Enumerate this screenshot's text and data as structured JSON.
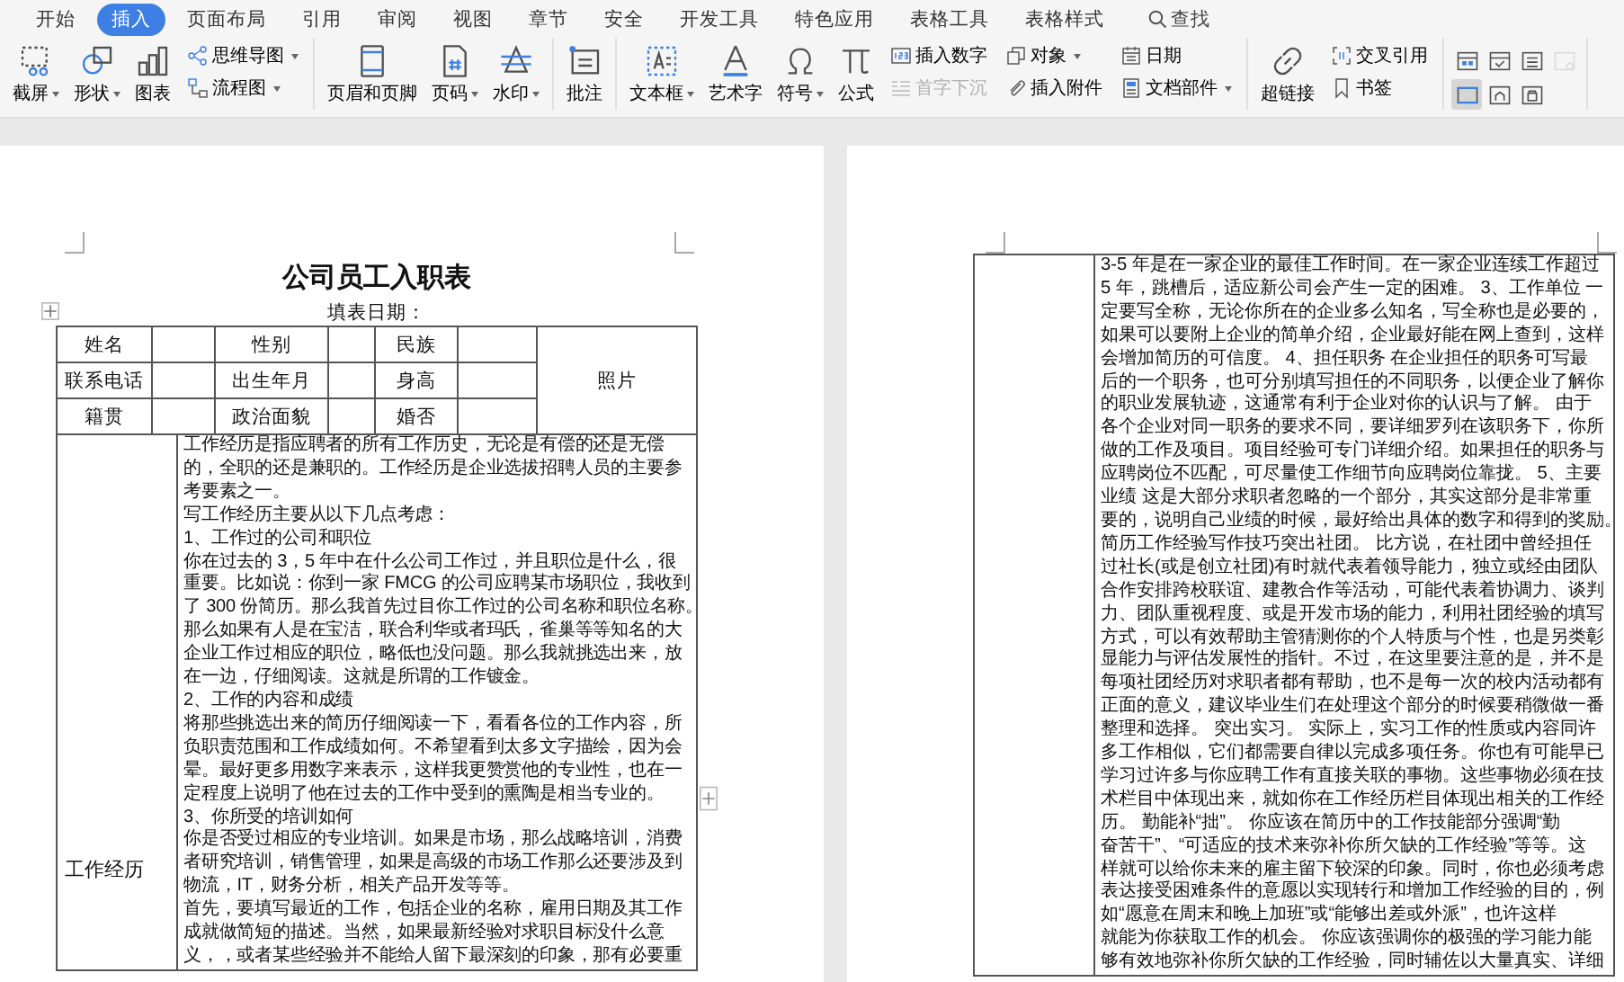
{
  "tabs": [
    {
      "label": "开始",
      "selected": false
    },
    {
      "label": "插入",
      "selected": true
    },
    {
      "label": "页面布局",
      "selected": false
    },
    {
      "label": "引用",
      "selected": false
    },
    {
      "label": "审阅",
      "selected": false
    },
    {
      "label": "视图",
      "selected": false
    },
    {
      "label": "章节",
      "selected": false
    },
    {
      "label": "安全",
      "selected": false
    },
    {
      "label": "开发工具",
      "selected": false
    },
    {
      "label": "特色应用",
      "selected": false
    },
    {
      "label": "表格工具",
      "selected": false
    },
    {
      "label": "表格样式",
      "selected": false
    }
  ],
  "search": {
    "label": "查找"
  },
  "ribbon": [
    {
      "columns": [
        {
          "kind": "large",
          "buttons": [
            {
              "label": "截屏",
              "dropdown": true,
              "disabled": false
            }
          ]
        },
        {
          "kind": "large",
          "buttons": [
            {
              "label": "形状",
              "dropdown": true,
              "disabled": false
            }
          ]
        },
        {
          "kind": "large",
          "buttons": [
            {
              "label": "图表",
              "dropdown": false,
              "disabled": false
            }
          ]
        },
        {
          "kind": "small",
          "buttons": [
            {
              "label": "思维导图",
              "dropdown": true,
              "disabled": false
            },
            {
              "label": "流程图",
              "dropdown": true,
              "disabled": false
            }
          ]
        }
      ]
    },
    {
      "columns": [
        {
          "kind": "large",
          "buttons": [
            {
              "label": "页眉和页脚",
              "dropdown": false,
              "disabled": false
            }
          ]
        },
        {
          "kind": "large",
          "buttons": [
            {
              "label": "页码",
              "dropdown": true,
              "disabled": false
            }
          ]
        },
        {
          "kind": "large",
          "buttons": [
            {
              "label": "水印",
              "dropdown": true,
              "disabled": false
            }
          ]
        }
      ]
    },
    {
      "columns": [
        {
          "kind": "large",
          "buttons": [
            {
              "label": "批注",
              "dropdown": false,
              "disabled": false
            }
          ]
        }
      ]
    },
    {
      "columns": [
        {
          "kind": "large",
          "buttons": [
            {
              "label": "文本框",
              "dropdown": true,
              "disabled": false
            }
          ]
        },
        {
          "kind": "large",
          "buttons": [
            {
              "label": "艺术字",
              "dropdown": false,
              "disabled": false
            }
          ]
        },
        {
          "kind": "large",
          "buttons": [
            {
              "label": "符号",
              "dropdown": true,
              "disabled": false
            }
          ]
        },
        {
          "kind": "large",
          "buttons": [
            {
              "label": "公式",
              "dropdown": false,
              "disabled": false
            }
          ]
        },
        {
          "kind": "small",
          "buttons": [
            {
              "label": "插入数字",
              "dropdown": false,
              "disabled": false
            },
            {
              "label": "首字下沉",
              "dropdown": false,
              "disabled": true
            }
          ]
        },
        {
          "kind": "small",
          "buttons": [
            {
              "label": "对象",
              "dropdown": true,
              "disabled": false
            },
            {
              "label": "插入附件",
              "dropdown": false,
              "disabled": false
            }
          ]
        },
        {
          "kind": "small",
          "buttons": [
            {
              "label": "日期",
              "dropdown": false,
              "disabled": false
            },
            {
              "label": "文档部件",
              "dropdown": true,
              "disabled": false
            }
          ]
        }
      ]
    },
    {
      "columns": [
        {
          "kind": "large",
          "buttons": [
            {
              "label": "超链接",
              "dropdown": false,
              "disabled": false
            }
          ]
        },
        {
          "kind": "small",
          "buttons": [
            {
              "label": "交叉引用",
              "dropdown": false,
              "disabled": false
            },
            {
              "label": "书签",
              "dropdown": false,
              "disabled": false
            }
          ]
        }
      ]
    },
    {
      "columns": [
        {
          "kind": "grid",
          "buttons": [
            {
              "selected": false,
              "disabled": false
            },
            {
              "selected": false,
              "disabled": false
            },
            {
              "selected": false,
              "disabled": false
            },
            {
              "selected": false,
              "disabled": true
            },
            {
              "selected": true,
              "disabled": false
            },
            {
              "selected": false,
              "disabled": false
            },
            {
              "selected": false,
              "disabled": false
            }
          ]
        }
      ]
    }
  ],
  "form": {
    "title": "公司员工入职表",
    "date_label": "填表日期：",
    "rows": [
      [
        "姓名",
        "性别",
        "民族"
      ],
      [
        "联系电话",
        "出生年月",
        "身高"
      ],
      [
        "籍贯",
        "政治面貌",
        "婚否"
      ]
    ],
    "photo_label": "照片",
    "experience_label": "工作经历",
    "experience_lines": [
      "工作经历是指应聘者的所有工作历史，无论是有偿的还是无偿",
      "的，全职的还是兼职的。工作经历是企业选拔招聘人员的主要参",
      "考要素之一。",
      "写工作经历主要从以下几点考虑：",
      "1、工作过的公司和职位",
      "你在过去的 3，5 年中在什么公司工作过，并且职位是什么，很",
      "重要。比如说：你到一家 FMCG 的公司应聘某市场职位，我收到",
      "了 300 份简历。那么我首先过目你工作过的公司名称和职位名称。",
      "那么如果有人是在宝洁，联合利华或者玛氏，雀巢等等知名的大",
      "企业工作过相应的职位，略低也没问题。那么我就挑选出来，放",
      "在一边，仔细阅读。这就是所谓的工作镀金。",
      "2、工作的内容和成绩",
      "将那些挑选出来的简历仔细阅读一下，看看各位的工作内容，所",
      "负职责范围和工作成绩如何。不希望看到太多文字描绘，因为会",
      "晕。最好更多用数字来表示，这样我更赞赏他的专业性，也在一",
      "定程度上说明了他在过去的工作中受到的熏陶是相当专业的。",
      "3、你所受的培训如何",
      "你是否受过相应的专业培训。如果是市场，那么战略培训，消费",
      "者研究培训，销售管理，如果是高级的市场工作那么还要涉及到",
      "物流，IT，财务分析，相关产品开发等等。",
      "首先，要填写最近的工作，包括企业的名称，雇用日期及其工作",
      "成就做简短的描述。当然，如果最新经验对求职目标没什么意",
      "义，，或者某些经验并不能给人留下最深刻的印象，那有必要重"
    ]
  },
  "continued_lines": [
    "3-5 年是在一家企业的最佳工作时间。在一家企业连续工作超过",
    "5 年，跳槽后，适应新公司会产生一定的困难。 3、工作单位 一",
    "定要写全称，无论你所在的企业多么知名，写全称也是必要的，",
    "如果可以要附上企业的简单介绍，企业最好能在网上查到，这样",
    "会增加简历的可信度。 4、担任职务 在企业担任的职务可写最",
    "后的一个职务，也可分别填写担任的不同职务，以便企业了解你",
    "的职业发展轨迹，这通常有利于企业对你的认识与了解。 由于",
    "各个企业对同一职务的要求不同，要详细罗列在该职务下，你所",
    "做的工作及项目。项目经验可专门详细介绍。如果担任的职务与",
    "应聘岗位不匹配，可尽量使工作细节向应聘岗位靠拢。 5、主要",
    "业绩 这是大部分求职者忽略的一个部分，其实这部分是非常重",
    "要的，说明自己业绩的时候，最好给出具体的数字和得到的奖励。",
    "简历工作经验写作技巧突出社团。 比方说，在社团中曾经担任",
    "过社长(或是创立社团)有时就代表着领导能力，独立或经由团队",
    "合作安排跨校联谊、建教合作等活动，可能代表着协调力、谈判",
    "力、团队重视程度、或是开发市场的能力，利用社团经验的填写",
    "方式，可以有效帮助主管猜测你的个人特质与个性，也是另类彰",
    "显能力与评估发展性的指针。不过，在这里要注意的是，并不是",
    "每项社团经历对求职者都有帮助，也不是每一次的校内活动都有",
    "正面的意义，建议毕业生们在处理这个部分的时候要稍微做一番",
    "整理和选择。 突出实习。 实际上，实习工作的性质或内容同许",
    "多工作相似，它们都需要自律以完成多项任务。你也有可能早已",
    "学习过许多与你应聘工作有直接关联的事物。这些事物必须在技",
    "术栏目中体现出来，就如你在工作经历栏目体现出相关的工作经",
    "历。 勤能补“拙”。 你应该在简历中的工作技能部分强调“勤",
    "奋苦干”、“可适应的技术来弥补你所欠缺的工作经验”等等。这",
    "样就可以给你未来的雇主留下较深的印象。同时，你也必须考虑",
    "表达接受困难条件的意愿以实现转行和增加工作经验的目的，例",
    "如“愿意在周末和晚上加班”或“能够出差或外派”，也许这样",
    "就能为你获取工作的机会。 你应该强调你的极强的学习能力能",
    "够有效地弥补你所欠缺的工作经验，同时辅佐以大量真实、详细"
  ]
}
